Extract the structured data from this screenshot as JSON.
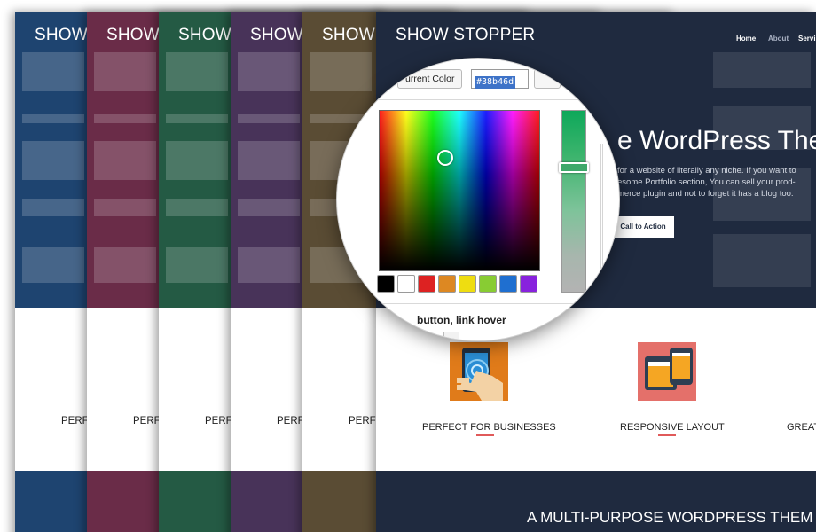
{
  "pages": [
    {
      "brand": "SHOW",
      "feature": "PERFE",
      "color": "#1e4470"
    },
    {
      "brand": "SHOW",
      "feature": "PERFE",
      "color": "#6a2c48"
    },
    {
      "brand": "SHOW",
      "feature": "PERFE",
      "color": "#245a44"
    },
    {
      "brand": "SHOW",
      "feature": "PERFE",
      "color": "#483359"
    },
    {
      "brand": "SHOW",
      "feature": "PERFE",
      "color": "#5a4c34"
    }
  ],
  "front": {
    "brand": "SHOW STOPPER",
    "color": "#1f2a3f",
    "nav": [
      "Home",
      "About",
      "Servi"
    ],
    "hero_title": "e WordPress Them",
    "hero_text": [
      "for a website of literally any niche. If you want to",
      "esome Portfolio section, You can sell your prod-",
      "merce plugin and not to forget it has a blog too."
    ],
    "cta_label": "Call to Action",
    "features": [
      "PERFECT FOR BUSINESSES",
      "RESPONSIVE LAYOUT",
      "GREAT"
    ],
    "tagline": "A MULTI-PURPOSE WORDPRESS THEM",
    "accent": "#e05a5a"
  },
  "color_picker": {
    "current_color_label": "urrent Color",
    "hex_value": "#38b46d",
    "swatches": [
      "#000000",
      "#ffffff",
      "#dd2222",
      "#dd8822",
      "#eedd11",
      "#88cc33",
      "#1f6fd0",
      "#8822dd"
    ],
    "selector_label": "button, link hover",
    "lightness_fraction": 0.3
  }
}
